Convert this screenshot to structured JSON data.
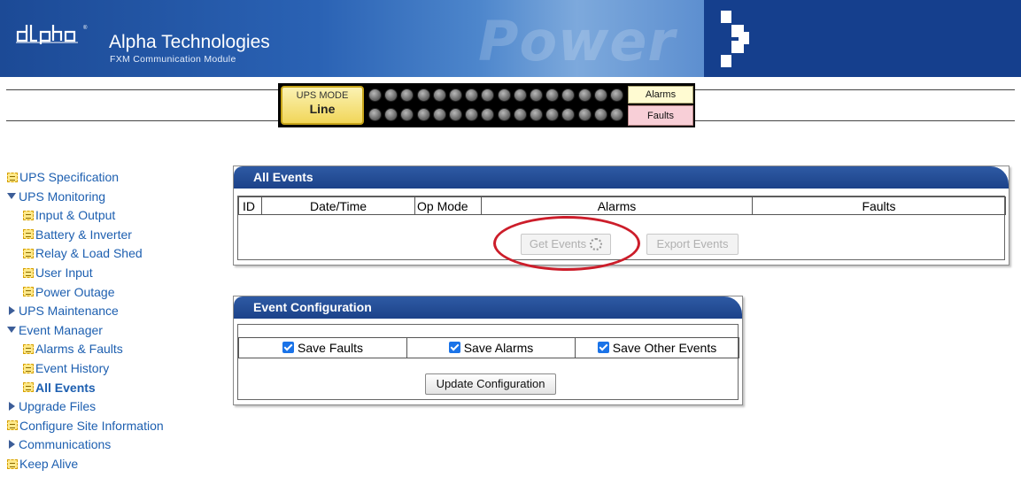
{
  "header": {
    "company": "Alpha Technologies",
    "module": "FXM Communication Module",
    "watermark": "Power",
    "colors": {
      "primary": "#1f4f9c",
      "dark": "#153f8d"
    }
  },
  "status_bar": {
    "mode_label": "UPS MODE",
    "mode_value": "Line",
    "alarms_label": "Alarms",
    "faults_label": "Faults",
    "leds_per_row": 16,
    "led_rows": 2
  },
  "sidebar": {
    "items": [
      {
        "label": "UPS Specification",
        "icon": "page-icon",
        "level": 0,
        "active": false
      },
      {
        "label": "UPS Monitoring",
        "icon": "expanded-arrow-icon",
        "level": 0,
        "active": false
      },
      {
        "label": "Input & Output",
        "icon": "page-icon",
        "level": 1,
        "active": false
      },
      {
        "label": "Battery & Inverter",
        "icon": "page-icon",
        "level": 1,
        "active": false
      },
      {
        "label": "Relay & Load Shed",
        "icon": "page-icon",
        "level": 1,
        "active": false
      },
      {
        "label": "User Input",
        "icon": "page-icon",
        "level": 1,
        "active": false
      },
      {
        "label": "Power Outage",
        "icon": "page-icon",
        "level": 1,
        "active": false
      },
      {
        "label": "UPS Maintenance",
        "icon": "collapsed-arrow-icon",
        "level": 0,
        "active": false
      },
      {
        "label": "Event Manager",
        "icon": "expanded-arrow-icon",
        "level": 0,
        "active": false
      },
      {
        "label": "Alarms & Faults",
        "icon": "page-icon",
        "level": 1,
        "active": false
      },
      {
        "label": "Event History",
        "icon": "page-icon",
        "level": 1,
        "active": false
      },
      {
        "label": "All Events",
        "icon": "page-icon",
        "level": 1,
        "active": true
      },
      {
        "label": "Upgrade Files",
        "icon": "collapsed-arrow-icon",
        "level": 0,
        "active": false
      },
      {
        "label": "Configure Site Information",
        "icon": "page-icon",
        "level": 0,
        "active": false
      },
      {
        "label": "Communications",
        "icon": "collapsed-arrow-icon",
        "level": 0,
        "active": false
      },
      {
        "label": "Keep Alive",
        "icon": "page-icon",
        "level": 0,
        "active": false
      }
    ]
  },
  "all_events": {
    "title": "All Events",
    "columns": [
      "ID",
      "Date/Time",
      "Op Mode",
      "Alarms",
      "Faults"
    ],
    "get_events_label": "Get Events",
    "export_events_label": "Export Events",
    "get_events_disabled": true,
    "export_events_disabled": true
  },
  "event_config": {
    "title": "Event Configuration",
    "options": [
      {
        "label": "Save Faults",
        "checked": true
      },
      {
        "label": "Save Alarms",
        "checked": true
      },
      {
        "label": "Save Other Events",
        "checked": true
      }
    ],
    "update_label": "Update Configuration"
  },
  "annotation": {
    "color": "#cc1d2a"
  }
}
